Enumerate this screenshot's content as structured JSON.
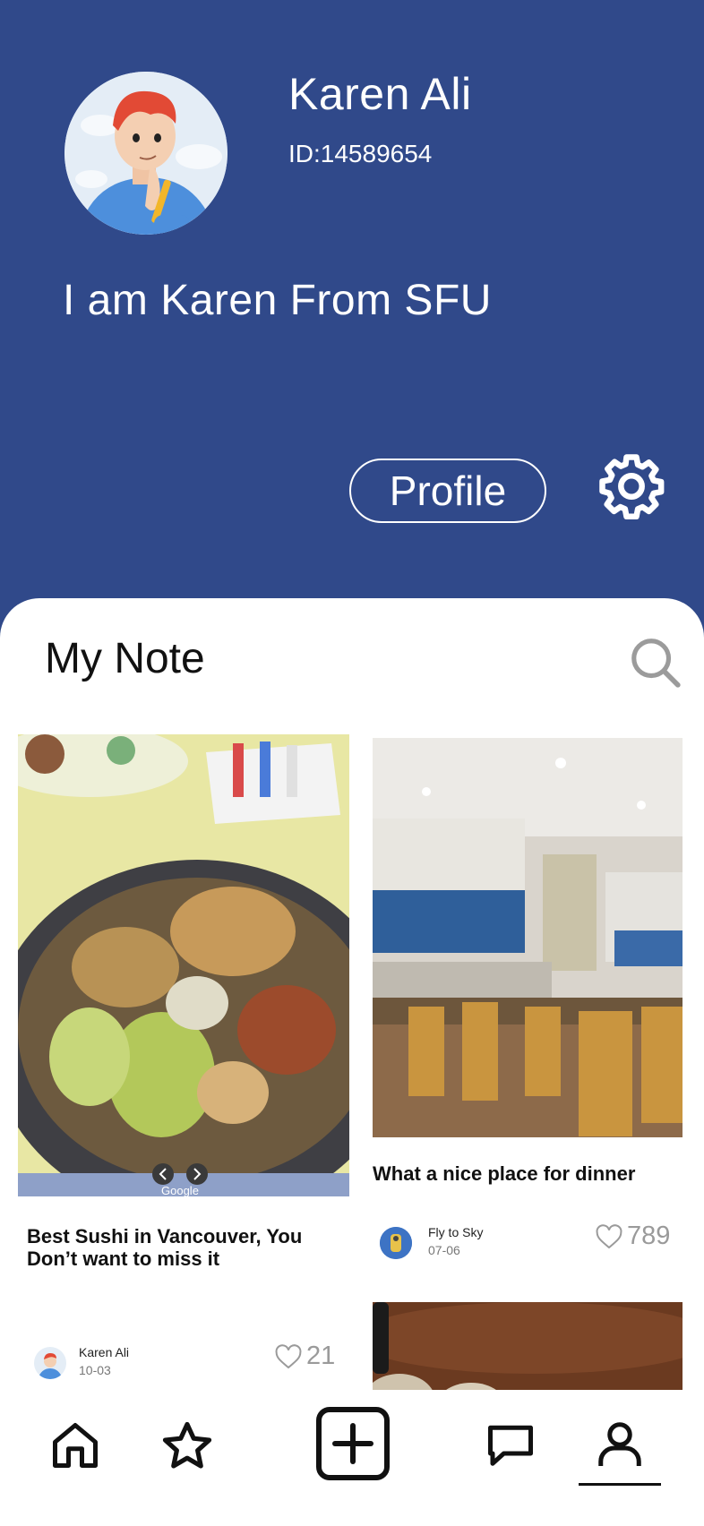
{
  "user": {
    "name": "Karen Ali",
    "id_text": "ID:14589654",
    "bio": "I am Karen From SFU"
  },
  "header": {
    "profile_button": "Profile",
    "settings_icon": "gear-icon",
    "background_color": "#30498a"
  },
  "notes": {
    "title": "My Note",
    "search_icon": "search-icon",
    "cards": [
      {
        "title": "Best Sushi in Vancouver, You Don’t want to miss it",
        "author": "Karen  Ali",
        "date": "10-03",
        "likes": "21",
        "image_watermark": "Google"
      },
      {
        "title": "What a nice place for dinner",
        "author": "Fly to Sky",
        "date": "07-06",
        "likes": "789"
      }
    ]
  },
  "tabbar": {
    "items": [
      "home-icon",
      "star-icon",
      "add-icon",
      "chat-icon",
      "user-icon"
    ],
    "active": "user-icon"
  }
}
